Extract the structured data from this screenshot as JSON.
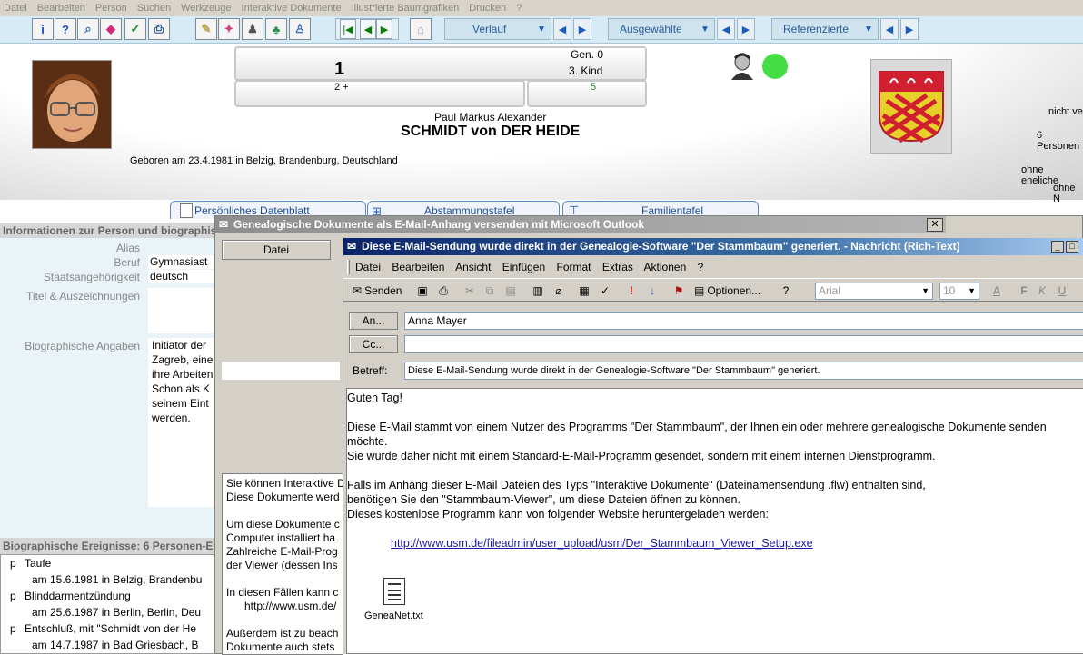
{
  "menubar": [
    "Datei",
    "Bearbeiten",
    "Person",
    "Suchen",
    "Werkzeuge",
    "Interaktive Dokumente",
    "Illustrierte Baumgrafiken",
    "Drucken",
    "?"
  ],
  "toolbar": {
    "verlauf": "Verlauf",
    "ausgewaehlte": "Ausgewählte",
    "referenzierte": "Referenzierte"
  },
  "person": {
    "number": "1",
    "gen": "Gen. 0",
    "kind": "3. Kind",
    "children": "2 +",
    "siblings": "5",
    "given_names": "Paul Markus Alexander",
    "surname": "SCHMIDT von DER HEIDE",
    "born": "Geboren am 23.4.1981 in Belzig, Brandenburg, Deutschland",
    "right_texts": [
      "nicht ve",
      "6 Personen",
      "ohne eheliche",
      "ohne N"
    ]
  },
  "tabs": [
    "Persönliches Datenblatt",
    "Abstammungstafel",
    "Familientafel"
  ],
  "info": {
    "header": "Informationen zur Person und biographische",
    "alias_label": "Alias",
    "beruf_label": "Beruf",
    "beruf_value": "Gymnasiast",
    "staat_label": "Staatsangehörigkeit",
    "staat_value": "deutsch",
    "titel_label": "Titel & Auszeichnungen",
    "bio_label": "Biographische Angaben",
    "bio_lines": [
      "Initiator der",
      "Zagreb, eine",
      "ihre Arbeiten",
      "Schon als K",
      "seinem Eint",
      "werden."
    ]
  },
  "events": {
    "header": "Biographische Ereignisse: 6 Personen-Er",
    "items": [
      {
        "mark": "p",
        "title": "Taufe",
        "detail": "am 15.6.1981 in Belzig, Brandenbu"
      },
      {
        "mark": "p",
        "title": "Blinddarmentzündung",
        "detail": "am 25.6.1987 in Berlin, Berlin, Deu"
      },
      {
        "mark": "p",
        "title": "Entschluß, mit \"Schmidt von der He",
        "detail": "am 14.7.1987 in Bad Griesbach, B"
      }
    ]
  },
  "dialog": {
    "title": "Genealogische Dokumente als E-Mail-Anhang versenden mit Microsoft Outlook",
    "close": "✕",
    "datei": "Datei",
    "left_text": [
      "Sie können Interaktive D",
      "Diese Dokumente werd",
      "",
      "Um diese Dokumente c",
      "Computer installiert ha",
      "Zahlreiche E-Mail-Prog",
      "der Viewer (dessen Ins",
      "",
      "In diesen Fällen kann c",
      "    http://www.usm.de/",
      "",
      "Außerdem ist zu beach",
      "Dokumente auch stets"
    ]
  },
  "outlook": {
    "title": "Diese E-Mail-Sendung wurde direkt in der Genealogie-Software \"Der Stammbaum\" generiert. - Nachricht (Rich-Text)",
    "menu": [
      "Datei",
      "Bearbeiten",
      "Ansicht",
      "Einfügen",
      "Format",
      "Extras",
      "Aktionen",
      "?"
    ],
    "send": "Senden",
    "options": "Optionen...",
    "font": "Arial",
    "size": "10",
    "to_label": "An...",
    "to_value": "Anna Mayer",
    "cc_label": "Cc...",
    "cc_value": "",
    "subject_label": "Betreff:",
    "subject_value": "Diese E-Mail-Sendung wurde direkt in der Genealogie-Software \"Der Stammbaum\" generiert.",
    "body": [
      "Guten Tag!",
      "",
      "Diese E-Mail stammt von einem Nutzer des Programms \"Der Stammbaum\", der Ihnen ein oder mehrere genealogische Dokumente senden",
      "möchte.",
      "Sie wurde daher nicht mit einem Standard-E-Mail-Programm gesendet, sondern mit einem internen Dienstprogramm.",
      "",
      "Falls im Anhang dieser E-Mail Dateien des Typs \"Interaktive Dokumente\" (Dateinamensendung .flw) enthalten sind,",
      "benötigen Sie den \"Stammbaum-Viewer\", um diese Dateien öffnen zu können.",
      "Dieses kostenlose Programm kann von folgender Website heruntergeladen werden:"
    ],
    "link": "http://www.usm.de/fileadmin/user_upload/usm/Der_Stammbaum_Viewer_Setup.exe",
    "attachment": "GeneaNet.txt"
  }
}
